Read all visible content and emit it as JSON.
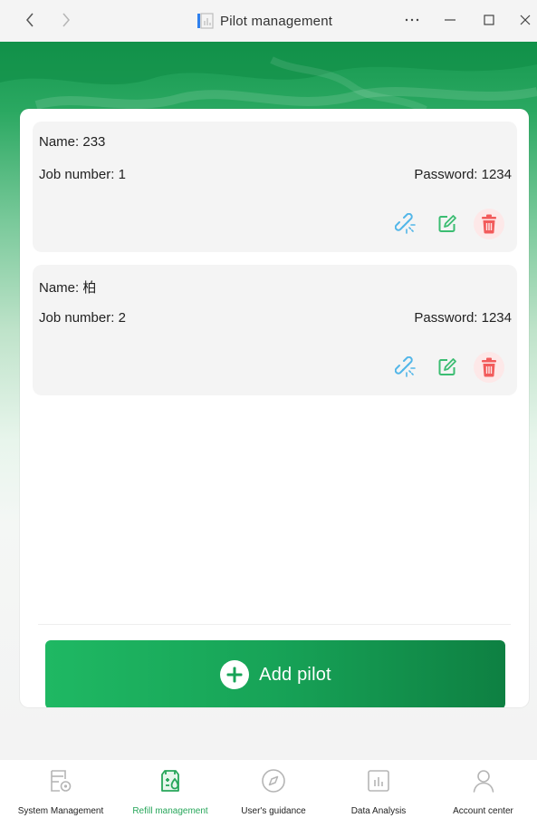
{
  "window": {
    "title": "Pilot management",
    "nav": {
      "back_icon": "chevron-left-icon",
      "forward_icon": "chevron-right-icon"
    },
    "controls": {
      "more_icon": "more-icon",
      "minimize_icon": "minimize-icon",
      "maximize_icon": "maximize-icon",
      "close_icon": "close-icon"
    }
  },
  "theme": {
    "brand_green": "#1fb863",
    "dark_green": "#0e8042",
    "active_tab": "#27a65a",
    "action_blue": "#52b6e8",
    "action_green": "#3bbd72",
    "action_red": "#f25b5b"
  },
  "pilots": [
    {
      "name_label": "Name:",
      "name": "233",
      "job_label": "Job number:",
      "job": "1",
      "password_label": "Password:",
      "password": "1234"
    },
    {
      "name_label": "Name:",
      "name": "柏",
      "job_label": "Job number:",
      "job": "2",
      "password_label": "Password:",
      "password": "1234"
    }
  ],
  "actions": {
    "unbind_icon": "unlink-icon",
    "edit_icon": "edit-icon",
    "delete_icon": "trash-icon"
  },
  "add_button": {
    "label": "Add pilot",
    "icon": "plus-circle-icon"
  },
  "tabs": [
    {
      "label": "System Management",
      "icon": "system-management-icon",
      "active": false
    },
    {
      "label": "Refill management",
      "icon": "refill-management-icon",
      "active": true
    },
    {
      "label": "User's guidance",
      "icon": "compass-icon",
      "active": false
    },
    {
      "label": "Data Analysis",
      "icon": "bar-chart-icon",
      "active": false
    },
    {
      "label": "Account center",
      "icon": "user-icon",
      "active": false
    }
  ]
}
